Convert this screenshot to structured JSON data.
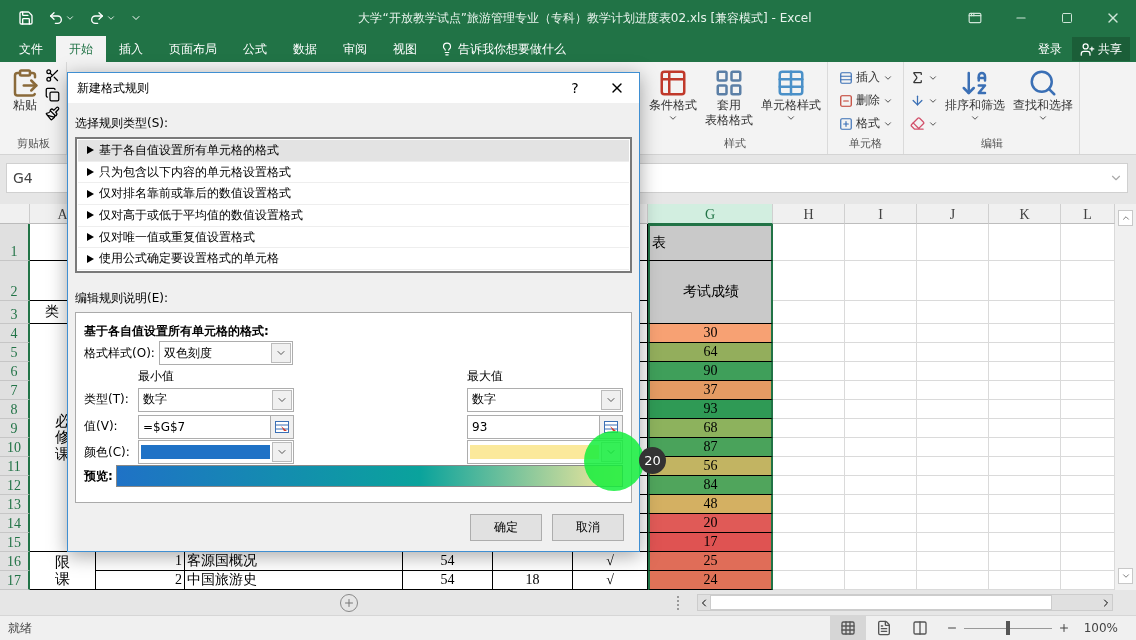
{
  "title_bar": {
    "title": "大学“开放教学试点”旅游管理专业（专科）教学计划进度表02.xls  [兼容模式]  -  Excel"
  },
  "menu_tabs": [
    {
      "label": "文件",
      "selected": false
    },
    {
      "label": "开始",
      "selected": true
    },
    {
      "label": "插入",
      "selected": false
    },
    {
      "label": "页面布局",
      "selected": false
    },
    {
      "label": "公式",
      "selected": false
    },
    {
      "label": "数据",
      "selected": false
    },
    {
      "label": "审阅",
      "selected": false
    },
    {
      "label": "视图",
      "selected": false
    }
  ],
  "tell_me": "告诉我你想要做什么",
  "account": {
    "sign_in": "登录",
    "share": "共享"
  },
  "ribbon": {
    "clipboard": {
      "paste": "粘贴",
      "label": "剪贴板"
    },
    "styles": {
      "label": "样式",
      "conditional": "条件格式",
      "table_top": "套用",
      "table_bottom": "表格格式",
      "cell_styles": "单元格样式"
    },
    "cells": {
      "label": "单元格",
      "insert": "插入",
      "delete": "删除",
      "format": "格式"
    },
    "editing": {
      "label": "编辑",
      "sort": "排序和筛选",
      "find": "查找和选择"
    }
  },
  "formula_bar": {
    "name_box": "G4"
  },
  "sheet": {
    "columns": [
      {
        "header": "A",
        "selected": false
      },
      {
        "header": "G",
        "selected": true
      },
      {
        "header": "H",
        "selected": false
      },
      {
        "header": "I",
        "selected": false
      },
      {
        "header": "J",
        "selected": false
      },
      {
        "header": "K",
        "selected": false
      },
      {
        "header": "L",
        "selected": false
      }
    ],
    "rows": [
      {
        "number": "1",
        "selected": true
      },
      {
        "number": "2",
        "selected": true
      },
      {
        "number": "3",
        "selected": true
      },
      {
        "number": "4",
        "selected": true
      },
      {
        "number": "5",
        "selected": true
      },
      {
        "number": "6",
        "selected": true
      },
      {
        "number": "7",
        "selected": true
      },
      {
        "number": "8",
        "selected": true
      },
      {
        "number": "9",
        "selected": true
      },
      {
        "number": "10",
        "selected": true
      },
      {
        "number": "11",
        "selected": true
      },
      {
        "number": "12",
        "selected": true
      },
      {
        "number": "13",
        "selected": true
      },
      {
        "number": "14",
        "selected": true
      },
      {
        "number": "15",
        "selected": true
      },
      {
        "number": "16",
        "selected": true
      },
      {
        "number": "17",
        "selected": true
      }
    ],
    "title_fragment": "表",
    "category_header": "类",
    "grade_header": "考试成绩",
    "required_label": "必修课",
    "elective_label": "限课",
    "grades": [
      {
        "text": "30",
        "color": "#f7a173"
      },
      {
        "text": "64",
        "color": "#93ae5c"
      },
      {
        "text": "90",
        "color": "#3f9f5a"
      },
      {
        "text": "37",
        "color": "#e49b63"
      },
      {
        "text": "93",
        "color": "#2f9a55"
      },
      {
        "text": "68",
        "color": "#8db25d"
      },
      {
        "text": "87",
        "color": "#4aa35b"
      },
      {
        "text": "56",
        "color": "#c2b462"
      },
      {
        "text": "84",
        "color": "#50a55c"
      },
      {
        "text": "48",
        "color": "#d4b062"
      },
      {
        "text": "20",
        "color": "#e05a57"
      },
      {
        "text": "17",
        "color": "#df5352"
      },
      {
        "text": "25",
        "color": "#e06d58"
      },
      {
        "text": "24",
        "color": "#e07257"
      }
    ],
    "courses": [
      {
        "number": "1",
        "name": "客源国概况",
        "column_4": "54",
        "column_6": "√"
      },
      {
        "number": "2",
        "name": "中国旅游史",
        "column_4": "54",
        "column_5": "18",
        "column_6": "√"
      }
    ]
  },
  "dialog": {
    "title": "新建格式规则",
    "help": "?",
    "rule_type_label": "选择规则类型(S):",
    "rule_types": [
      {
        "label": "基于各自值设置所有单元格的格式",
        "selected": true
      },
      {
        "label": "只为包含以下内容的单元格设置格式",
        "selected": false
      },
      {
        "label": "仅对排名靠前或靠后的数值设置格式",
        "selected": false
      },
      {
        "label": "仅对高于或低于平均值的数值设置格式",
        "selected": false
      },
      {
        "label": "仅对唯一值或重复值设置格式",
        "selected": false
      },
      {
        "label": "使用公式确定要设置格式的单元格",
        "selected": false
      }
    ],
    "description_label": "编辑规则说明(E):",
    "heading": "基于各自值设置所有单元格的格式:",
    "format_style": {
      "label": "格式样式(O):",
      "value": "双色刻度"
    },
    "type_label": "类型(T):",
    "value_label": "值(V):",
    "color_label": "颜色(C):",
    "preview_label": "预览:",
    "min": {
      "heading": "最小值",
      "type": "数字",
      "value": "=$G$7",
      "color": "#1f72c6"
    },
    "max": {
      "heading": "最大值",
      "type": "数字",
      "value": "93",
      "color": "#fbe99b"
    },
    "buttons": [
      "确定",
      "取消"
    ]
  },
  "click_marker": {
    "step": "20"
  },
  "status_bar": {
    "status": "就绪",
    "views": [
      {
        "kind": "normal",
        "selected": true
      },
      {
        "kind": "page_layout",
        "selected": false
      },
      {
        "kind": "page_break",
        "selected": false
      }
    ],
    "zoom": {
      "level": 0.5,
      "reading": "100%"
    }
  }
}
